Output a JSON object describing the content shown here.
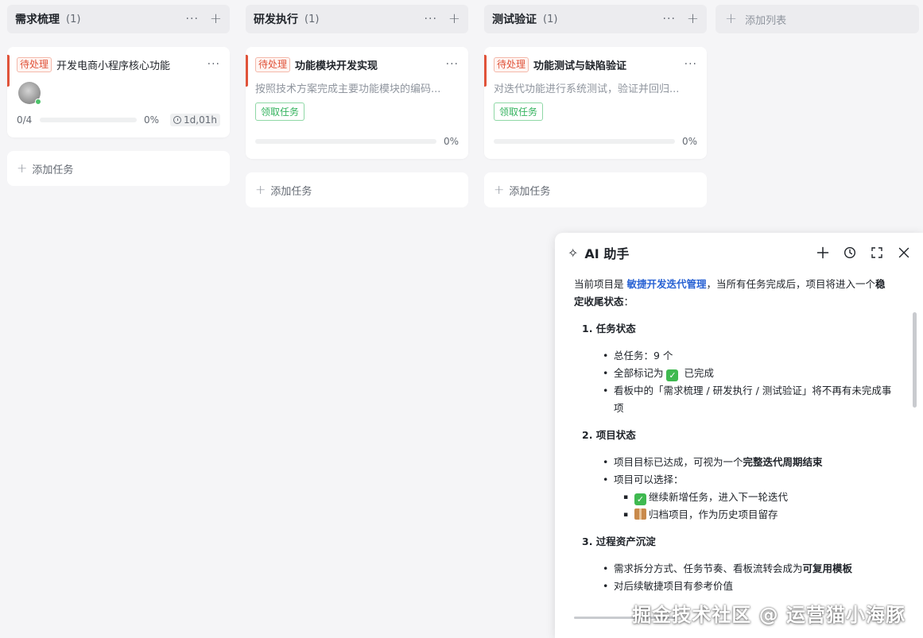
{
  "columns": [
    {
      "title": "需求梳理",
      "count": "(1)",
      "card": {
        "tag": "待处理",
        "title": "开发电商小程序核心功能",
        "progress_label": "0/4",
        "progress": 0,
        "progress_pct": "0%",
        "duration": "1d,01h"
      },
      "add_task": "添加任务"
    },
    {
      "title": "研发执行",
      "count": "(1)",
      "card": {
        "tag": "待处理",
        "title": "功能模块开发实现",
        "desc": "按照技术方案完成主要功能模块的编码...",
        "claim": "领取任务",
        "progress": 0,
        "progress_pct": "0%"
      },
      "add_task": "添加任务"
    },
    {
      "title": "测试验证",
      "count": "(1)",
      "card": {
        "tag": "待处理",
        "title": "功能测试与缺陷验证",
        "desc": "对迭代功能进行系统测试，验证并回归...",
        "claim": "领取任务",
        "progress": 0,
        "progress_pct": "0%"
      },
      "add_task": "添加任务"
    }
  ],
  "add_list": "添加列表",
  "ai": {
    "title": "AI 助手",
    "intro_prefix": "当前项目是 ",
    "intro_link": "敏捷开发迭代管理",
    "intro_mid": "，当所有任务完成后，项目将进入一个",
    "intro_bold": "稳定收尾状态",
    "intro_suffix": "：",
    "section1": {
      "title": "1. 任务状态",
      "item1": "总任务：9 个",
      "item2_prefix": "全部标记为 ",
      "item2_suffix": " 已完成",
      "item3": "看板中的「需求梳理 / 研发执行 / 测试验证」将不再有未完成事项"
    },
    "section2": {
      "title": "2. 项目状态",
      "item1_prefix": "项目目标已达成，可视为一个",
      "item1_bold": "完整迭代周期结束",
      "item2": "项目可以选择：",
      "sub1": "继续新增任务，进入下一轮迭代",
      "sub2": "归档项目，作为历史项目留存"
    },
    "section3": {
      "title": "3. 过程资产沉淀",
      "item1_prefix": "需求拆分方式、任务节奏、看板流转会成为",
      "item1_bold": "可复用模板",
      "item2": "对后续敏捷项目有参考价值"
    }
  },
  "watermark": "掘金技术社区 @ 运营猫小海豚",
  "colors": {
    "accent": "#3370ff",
    "todo_tag": "#e0533a",
    "claim_green": "#34b35e",
    "link_blue": "#2a63d4"
  }
}
